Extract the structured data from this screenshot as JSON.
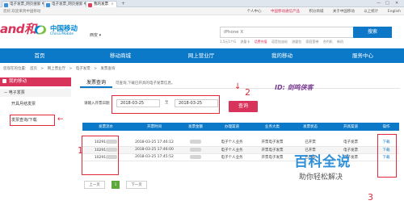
{
  "browser": {
    "tabs": [
      {
        "label": "电子发票_网页搜索 中国"
      },
      {
        "label": "电子发票_网页搜索 中国"
      },
      {
        "label": "我的发票"
      }
    ],
    "new_tab": "+",
    "window_controls": [
      "—",
      "□",
      "✕"
    ]
  },
  "topbar": {
    "left_text": "您好,欢迎来到中国移动",
    "links": [
      "个人中心",
      "中国移动通信产品",
      "积分商城",
      "关于中国移动",
      "以上统计",
      "English"
    ]
  },
  "header": {
    "logo_and": "and和",
    "logo_cn": "中国移动",
    "logo_en": "China Mobile",
    "city": "西安",
    "search_placeholder": "iPhone X",
    "search_button": "搜索",
    "hotwords": [
      "1.5元1个G",
      "流量卡",
      "话费充值",
      "语音加油站",
      "流量包",
      "家庭宽带",
      "合约机",
      "新机"
    ]
  },
  "nav": {
    "items": [
      "首页",
      "移动商城",
      "网上营业厅",
      "我的移动",
      "服务中心"
    ]
  },
  "breadcrumb": [
    "您现在的位置:",
    "首页",
    ">",
    "网上营业厅",
    ">",
    "电子发票",
    ">",
    "发票查询"
  ],
  "sidebar": {
    "header": "我的移动",
    "section": "电子发票",
    "items": [
      "开具月结发票",
      "发票查询/下载"
    ]
  },
  "main": {
    "title": "发票查询",
    "hint": "可查询,下载已开具的电子发票信息。",
    "date_label": "请输入开票日期",
    "date_from": "2018-03-25",
    "date_to_label": "至",
    "date_to": "2018-03-25",
    "query_button": "查询"
  },
  "annotations": {
    "step1": "1",
    "step2": "2",
    "step3": "3",
    "watermark": "ID: 剑鸣侠客",
    "arrow_down": "↓",
    "arrow_left": "←"
  },
  "table": {
    "headers": [
      "发票流水",
      "开票时间",
      "发票金额",
      "办理渠道",
      "业务大类",
      "发票状态",
      "开具渠道",
      "操作"
    ],
    "rows": [
      [
        "10291",
        "2018-03-25 17:46:12",
        "",
        "电子个人业务",
        "开票电子发票",
        "已开票",
        "电子发票",
        "下载"
      ],
      [
        "10291",
        "2018-03-25 17:46:00",
        "",
        "电子个人业务",
        "开票电子发票",
        "已开票",
        "电子发票",
        "下载"
      ],
      [
        "10291",
        "2018-03-25 17:45:52",
        "",
        "电子个人业务",
        "开票电子发票",
        "已开票",
        "电子发票",
        "下载"
      ]
    ]
  },
  "pager": {
    "prev": "上一页",
    "current": "1",
    "next": "下一页"
  },
  "baike": {
    "main": "百科全说",
    "sub": "助你轻松解决"
  }
}
